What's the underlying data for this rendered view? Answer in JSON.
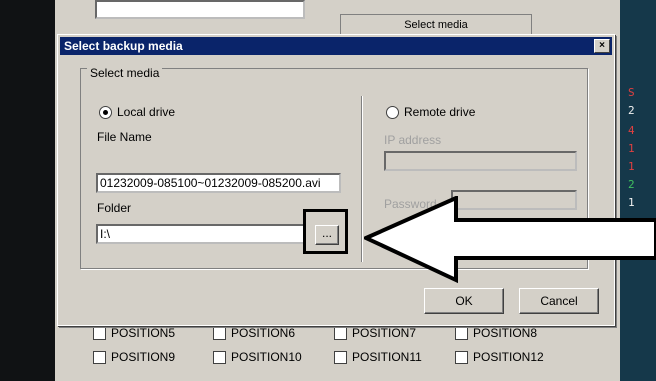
{
  "background": {
    "top_button_label": "Select media",
    "right_panel_chars": [
      "S",
      "2",
      "4",
      "1",
      "1",
      "2",
      "1"
    ],
    "position_labels_row": [
      "POSITION5",
      "POSITION6",
      "POSITION7",
      "POSITION8"
    ],
    "position_labels": [
      "POSITION9",
      "POSITION10",
      "POSITION11",
      "POSITION12"
    ]
  },
  "dialog": {
    "title": "Select backup media",
    "close_glyph": "×",
    "group_label": "Select media",
    "local_drive_label": "Local drive",
    "file_name_label": "File Name",
    "file_name_value": "01232009-085100~01232009-085200.avi",
    "folder_label": "Folder",
    "folder_value": "I:\\",
    "browse_label": "...",
    "remote_drive_label": "Remote drive",
    "ip_address_label": "IP address",
    "password_label": "Password",
    "ok_label": "OK",
    "cancel_label": "Cancel"
  },
  "colors": {
    "titlebar": "#0a246a",
    "dialog_face": "#d4d0c8",
    "annotation_arrow": "#000000"
  }
}
